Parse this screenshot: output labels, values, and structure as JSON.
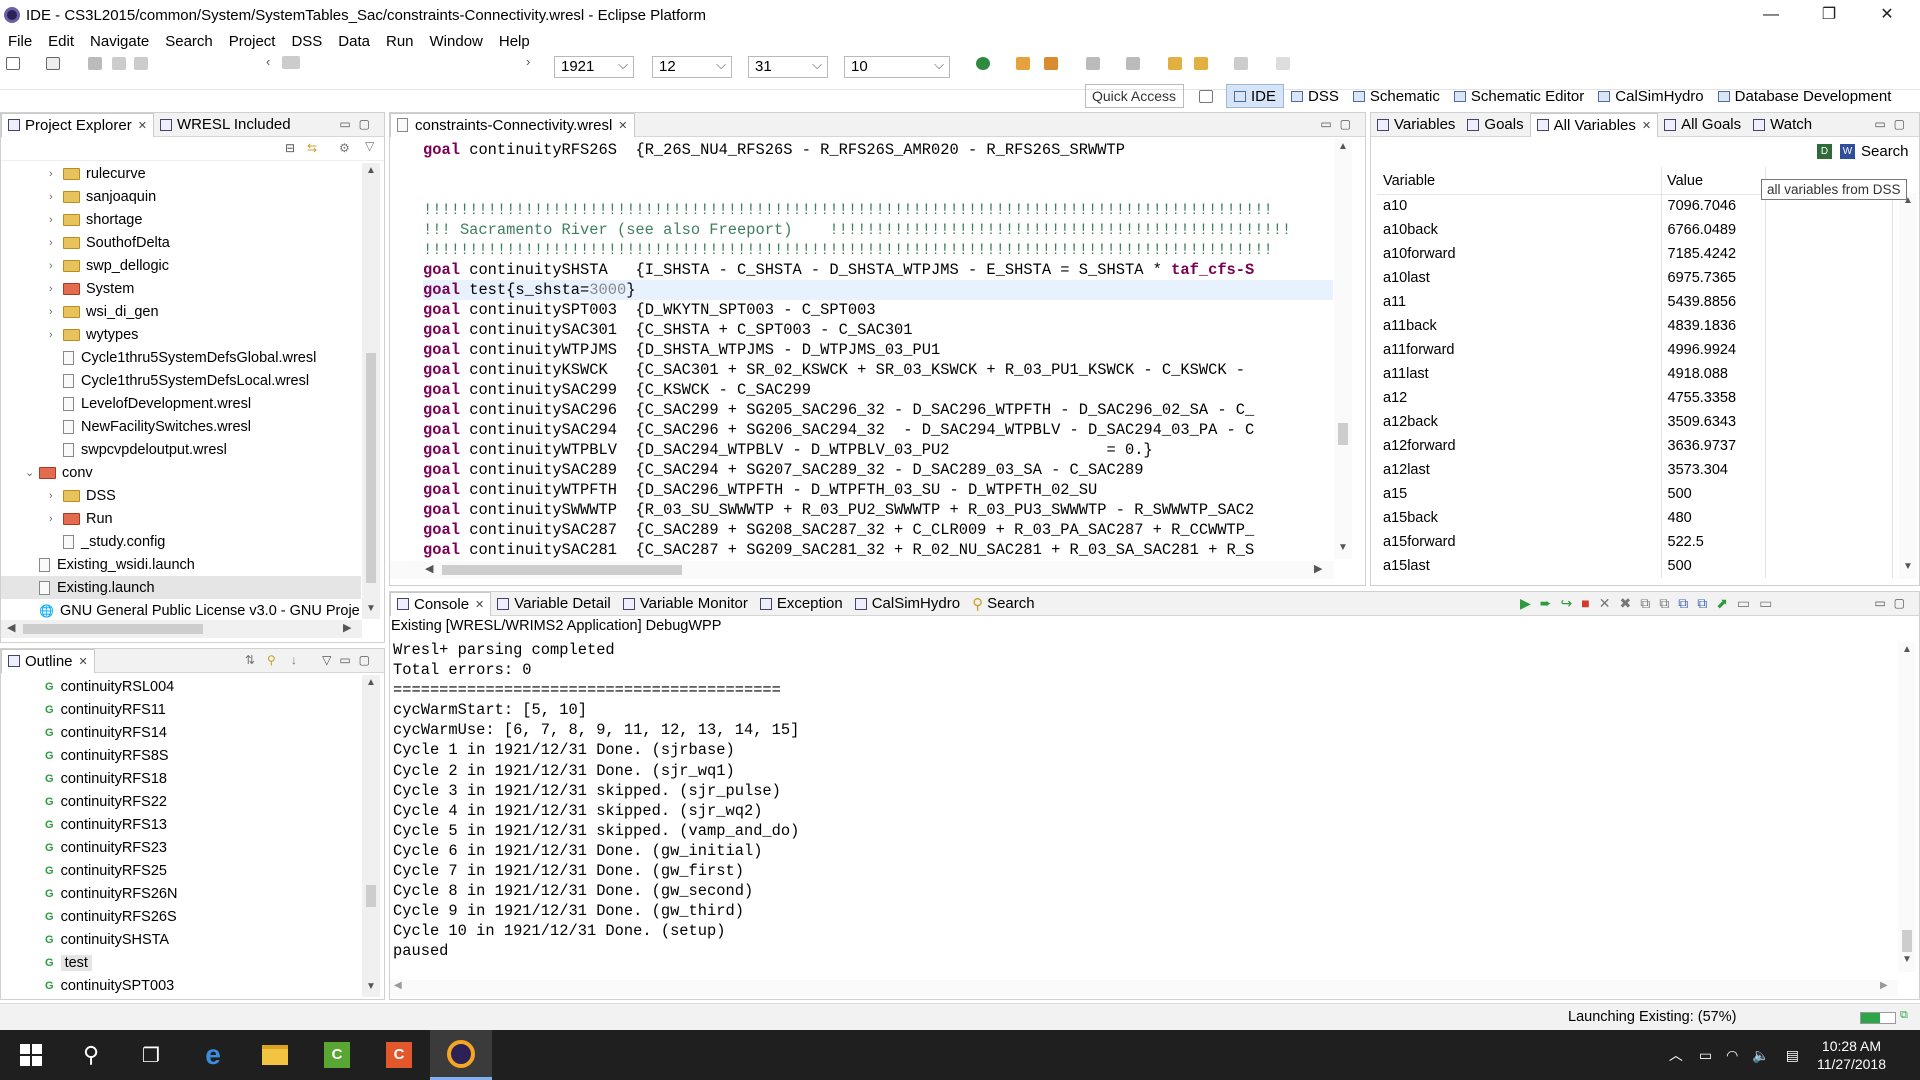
{
  "window": {
    "title": "IDE - CS3L2015/common/System/SystemTables_Sac/constraints-Connectivity.wresl - Eclipse Platform"
  },
  "menu": [
    "File",
    "Edit",
    "Navigate",
    "Search",
    "Project",
    "DSS",
    "Data",
    "Run",
    "Window",
    "Help"
  ],
  "toolbar": {
    "year": "1921",
    "month": "12",
    "day": "31",
    "cycles": "10",
    "quick_access": "Quick Access"
  },
  "perspectives": [
    "IDE",
    "DSS",
    "Schematic",
    "Schematic Editor",
    "CalSimHydro",
    "Database Development"
  ],
  "project_explorer": {
    "tabs": [
      "Project Explorer",
      "WRESL Included"
    ],
    "items": [
      {
        "label": "rulecurve",
        "type": "folder",
        "indent": 1,
        "expand": ">"
      },
      {
        "label": "sanjoaquin",
        "type": "folder",
        "indent": 1,
        "expand": ">"
      },
      {
        "label": "shortage",
        "type": "folder",
        "indent": 1,
        "expand": ">"
      },
      {
        "label": "SouthofDelta",
        "type": "folder",
        "indent": 1,
        "expand": ">"
      },
      {
        "label": "swp_dellogic",
        "type": "folder",
        "indent": 1,
        "expand": ">"
      },
      {
        "label": "System",
        "type": "redfolder",
        "indent": 1,
        "expand": ">"
      },
      {
        "label": "wsi_di_gen",
        "type": "folder",
        "indent": 1,
        "expand": ">"
      },
      {
        "label": "wytypes",
        "type": "folder",
        "indent": 1,
        "expand": ">"
      },
      {
        "label": "Cycle1thru5SystemDefsGlobal.wresl",
        "type": "file",
        "indent": 1,
        "expand": ""
      },
      {
        "label": "Cycle1thru5SystemDefsLocal.wresl",
        "type": "file",
        "indent": 1,
        "expand": ""
      },
      {
        "label": "LevelofDevelopment.wresl",
        "type": "file",
        "indent": 1,
        "expand": ""
      },
      {
        "label": "NewFacilitySwitches.wresl",
        "type": "file",
        "indent": 1,
        "expand": ""
      },
      {
        "label": "swpcvpdeloutput.wresl",
        "type": "file",
        "indent": 1,
        "expand": ""
      },
      {
        "label": "conv",
        "type": "redfolder",
        "indent": 0,
        "expand": "v"
      },
      {
        "label": "DSS",
        "type": "folder",
        "indent": 1,
        "expand": ">"
      },
      {
        "label": "Run",
        "type": "redfolder",
        "indent": 1,
        "expand": ">"
      },
      {
        "label": "_study.config",
        "type": "file",
        "indent": 1,
        "expand": ""
      },
      {
        "label": "Existing_wsidi.launch",
        "type": "file",
        "indent": 0,
        "expand": ""
      },
      {
        "label": "Existing.launch",
        "type": "file",
        "indent": 0,
        "expand": "",
        "selected": true
      },
      {
        "label": "GNU General Public License v3.0 - GNU Proje",
        "type": "globe",
        "indent": 0,
        "expand": ""
      }
    ]
  },
  "outline": {
    "tab": "Outline",
    "items": [
      "continuityRSL004",
      "continuityRFS11",
      "continuityRFS14",
      "continuityRFS8S",
      "continuityRFS18",
      "continuityRFS22",
      "continuityRFS13",
      "continuityRFS23",
      "continuityRFS25",
      "continuityRFS26N",
      "continuityRFS26S",
      "continuitySHSTA",
      "test",
      "continuitySPT003"
    ],
    "selected": "test"
  },
  "editor": {
    "tab": "constraints-Connectivity.wresl",
    "lines": [
      {
        "kind": "goal",
        "name": "continuityRFS26S  ",
        "expr": "{R_26S_NU4_RFS26S - R_RFS26S_AMR020 - R_RFS26S_SRWWTP"
      },
      {
        "kind": "blank"
      },
      {
        "kind": "blank"
      },
      {
        "kind": "comment",
        "text": "!!!!!!!!!!!!!!!!!!!!!!!!!!!!!!!!!!!!!!!!!!!!!!!!!!!!!!!!!!!!!!!!!!!!!!!!!!!!!!!!!!!!!!!!!!!!"
      },
      {
        "kind": "comment",
        "text": "!!! Sacramento River (see also Freeport)    !!!!!!!!!!!!!!!!!!!!!!!!!!!!!!!!!!!!!!!!!!!!!!!!!!"
      },
      {
        "kind": "comment",
        "text": "!!!!!!!!!!!!!!!!!!!!!!!!!!!!!!!!!!!!!!!!!!!!!!!!!!!!!!!!!!!!!!!!!!!!!!!!!!!!!!!!!!!!!!!!!!!!"
      },
      {
        "kind": "goal",
        "name": "continuitySHSTA   ",
        "expr": "{I_SHSTA - C_SHSTA - D_SHSTA_WTPJMS - E_SHSTA = S_SHSTA * ",
        "tail": "taf_cfs-S"
      },
      {
        "kind": "test",
        "name": "test",
        "expr": "{s_shsta=",
        "num": "3000",
        "close": "}"
      },
      {
        "kind": "goal",
        "name": "continuitySPT003  ",
        "expr": "{D_WKYTN_SPT003 - C_SPT003"
      },
      {
        "kind": "goal",
        "name": "continuitySAC301  ",
        "expr": "{C_SHSTA + C_SPT003 - C_SAC301"
      },
      {
        "kind": "goal",
        "name": "continuityWTPJMS  ",
        "expr": "{D_SHSTA_WTPJMS - D_WTPJMS_03_PU1"
      },
      {
        "kind": "goal",
        "name": "continuityKSWCK   ",
        "expr": "{C_SAC301 + SR_02_KSWCK + SR_03_KSWCK + R_03_PU1_KSWCK - C_KSWCK -"
      },
      {
        "kind": "goal",
        "name": "continuitySAC299  ",
        "expr": "{C_KSWCK - C_SAC299"
      },
      {
        "kind": "goal",
        "name": "continuitySAC296  ",
        "expr": "{C_SAC299 + SG205_SAC296_32 - D_SAC296_WTPFTH - D_SAC296_02_SA - C_"
      },
      {
        "kind": "goal",
        "name": "continuitySAC294  ",
        "expr": "{C_SAC296 + SG206_SAC294_32  - D_SAC294_WTPBLV - D_SAC294_03_PA - C"
      },
      {
        "kind": "goal",
        "name": "continuityWTPBLV  ",
        "expr": "{D_SAC294_WTPBLV - D_WTPBLV_03_PU2                 = 0.}"
      },
      {
        "kind": "goal",
        "name": "continuitySAC289  ",
        "expr": "{C_SAC294 + SG207_SAC289_32 - D_SAC289_03_SA - C_SAC289"
      },
      {
        "kind": "goal",
        "name": "continuityWTPFTH  ",
        "expr": "{D_SAC296_WTPFTH - D_WTPFTH_03_SU - D_WTPFTH_02_SU"
      },
      {
        "kind": "goal",
        "name": "continuitySWWWTP  ",
        "expr": "{R_03_SU_SWWWTP + R_03_PU2_SWWWTP + R_03_PU3_SWWWTP - R_SWWWTP_SAC2"
      },
      {
        "kind": "goal",
        "name": "continuitySAC287  ",
        "expr": "{C_SAC289 + SG208_SAC287_32 + C_CLR009 + R_03_PA_SAC287 + R_CCWWTP_"
      },
      {
        "kind": "goal",
        "name": "continuitySAC281  ",
        "expr": "{C_SAC287 + SG209_SAC281_32 + R_02_NU_SAC281 + R_03_SA_SAC281 + R_S"
      }
    ]
  },
  "variables_view": {
    "tabs": [
      "Variables",
      "Goals",
      "All Variables",
      "All Goals",
      "Watch"
    ],
    "active_tab": "All Variables",
    "search_label": "Search",
    "tooltip": "all variables from DSS",
    "headers": [
      "Variable",
      "Value"
    ],
    "rows": [
      [
        "a10",
        "7096.7046"
      ],
      [
        "a10back",
        "6766.0489"
      ],
      [
        "a10forward",
        "7185.4242"
      ],
      [
        "a10last",
        "6975.7365"
      ],
      [
        "a11",
        "5439.8856"
      ],
      [
        "a11back",
        "4839.1836"
      ],
      [
        "a11forward",
        "4996.9924"
      ],
      [
        "a11last",
        "4918.088"
      ],
      [
        "a12",
        "4755.3358"
      ],
      [
        "a12back",
        "3509.6343"
      ],
      [
        "a12forward",
        "3636.9737"
      ],
      [
        "a12last",
        "3573.304"
      ],
      [
        "a15",
        "500"
      ],
      [
        "a15back",
        "480"
      ],
      [
        "a15forward",
        "522.5"
      ],
      [
        "a15last",
        "500"
      ]
    ]
  },
  "console": {
    "tabs": [
      "Console",
      "Variable Detail",
      "Variable Monitor",
      "Exception",
      "CalSimHydro",
      "Search"
    ],
    "header": "Existing [WRESL/WRIMS2 Application] DebugWPP",
    "lines": [
      "Wresl+ parsing completed",
      "Total errors: 0",
      "==========================================",
      "cycWarmStart: [5, 10]",
      "cycWarmUse: [6, 7, 8, 9, 11, 12, 13, 14, 15]",
      "Cycle 1 in 1921/12/31 Done. (sjrbase)",
      "Cycle 2 in 1921/12/31 Done. (sjr_wq1)",
      "Cycle 3 in 1921/12/31 skipped. (sjr_pulse)",
      "Cycle 4 in 1921/12/31 skipped. (sjr_wq2)",
      "Cycle 5 in 1921/12/31 skipped. (vamp_and_do)",
      "Cycle 6 in 1921/12/31 Done. (gw_initial)",
      "Cycle 7 in 1921/12/31 Done. (gw_first)",
      "Cycle 8 in 1921/12/31 Done. (gw_second)",
      "Cycle 9 in 1921/12/31 Done. (gw_third)",
      "Cycle 10 in 1921/12/31 Done. (setup)",
      "paused"
    ]
  },
  "status": {
    "text": "Launching Existing: (57%)",
    "progress": 0.57
  },
  "taskbar": {
    "time": "10:28 AM",
    "date": "11/27/2018"
  }
}
